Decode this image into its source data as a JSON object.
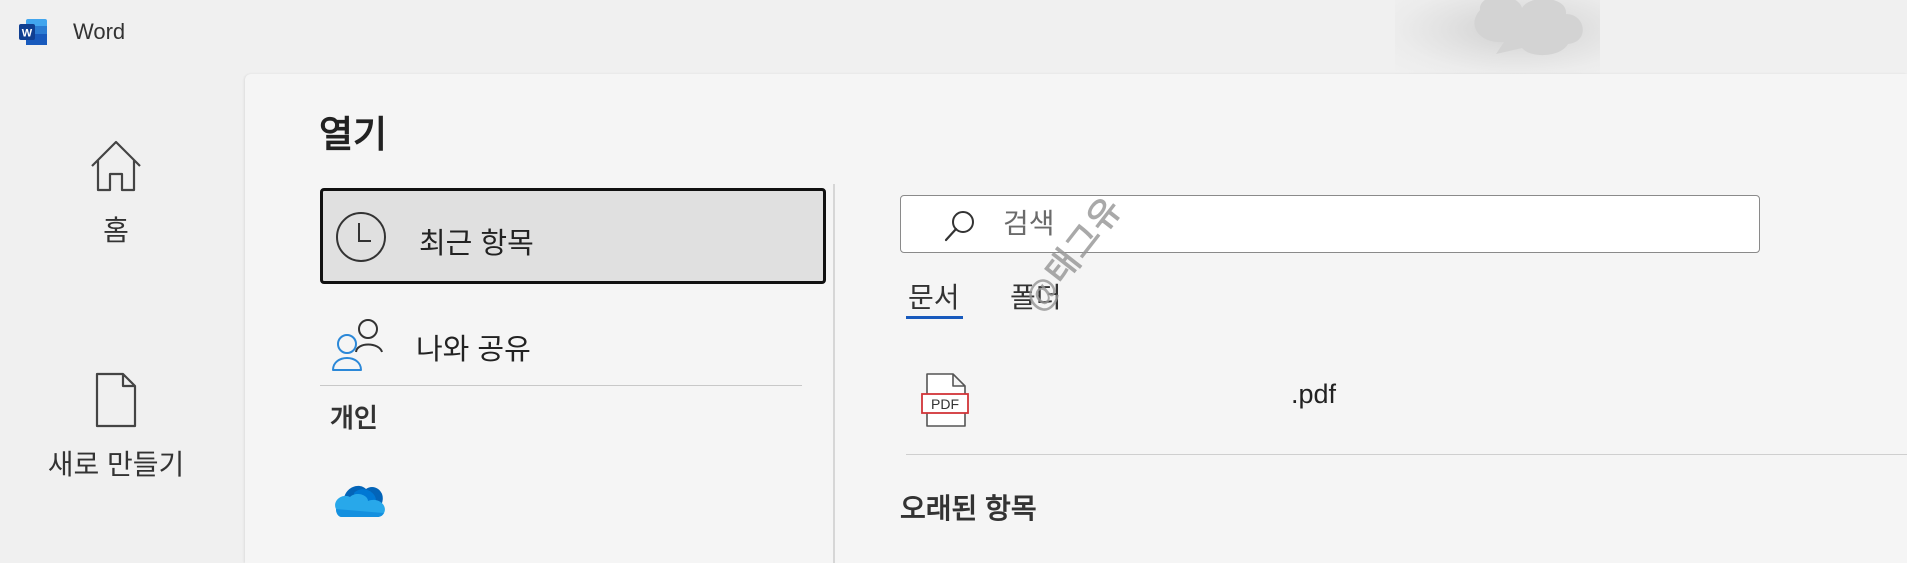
{
  "app": {
    "title": "Word",
    "logo_letter": "W",
    "brand_color": "#185abd"
  },
  "nav": {
    "home": {
      "label": "홈",
      "icon": "home-icon"
    },
    "new": {
      "label": "새로 만들기",
      "icon": "new-document-icon"
    }
  },
  "page": {
    "title": "열기"
  },
  "locations": {
    "recent": {
      "label": "최근 항목",
      "icon": "clock-icon",
      "selected": true
    },
    "shared": {
      "label": "나와 공유",
      "icon": "people-icon"
    },
    "personal_header": "개인",
    "onedrive": {
      "icon": "onedrive-icon"
    }
  },
  "search": {
    "placeholder": "검색",
    "value": ""
  },
  "tabs": [
    {
      "label": "문서",
      "selected": true
    },
    {
      "label": "폴더",
      "selected": false
    }
  ],
  "recent_files": [
    {
      "name": ".pdf",
      "icon": "pdf-file-icon",
      "icon_label": "PDF"
    }
  ],
  "older_section": {
    "title": "오래된 항목"
  },
  "watermark": {
    "text": "@태그유"
  }
}
